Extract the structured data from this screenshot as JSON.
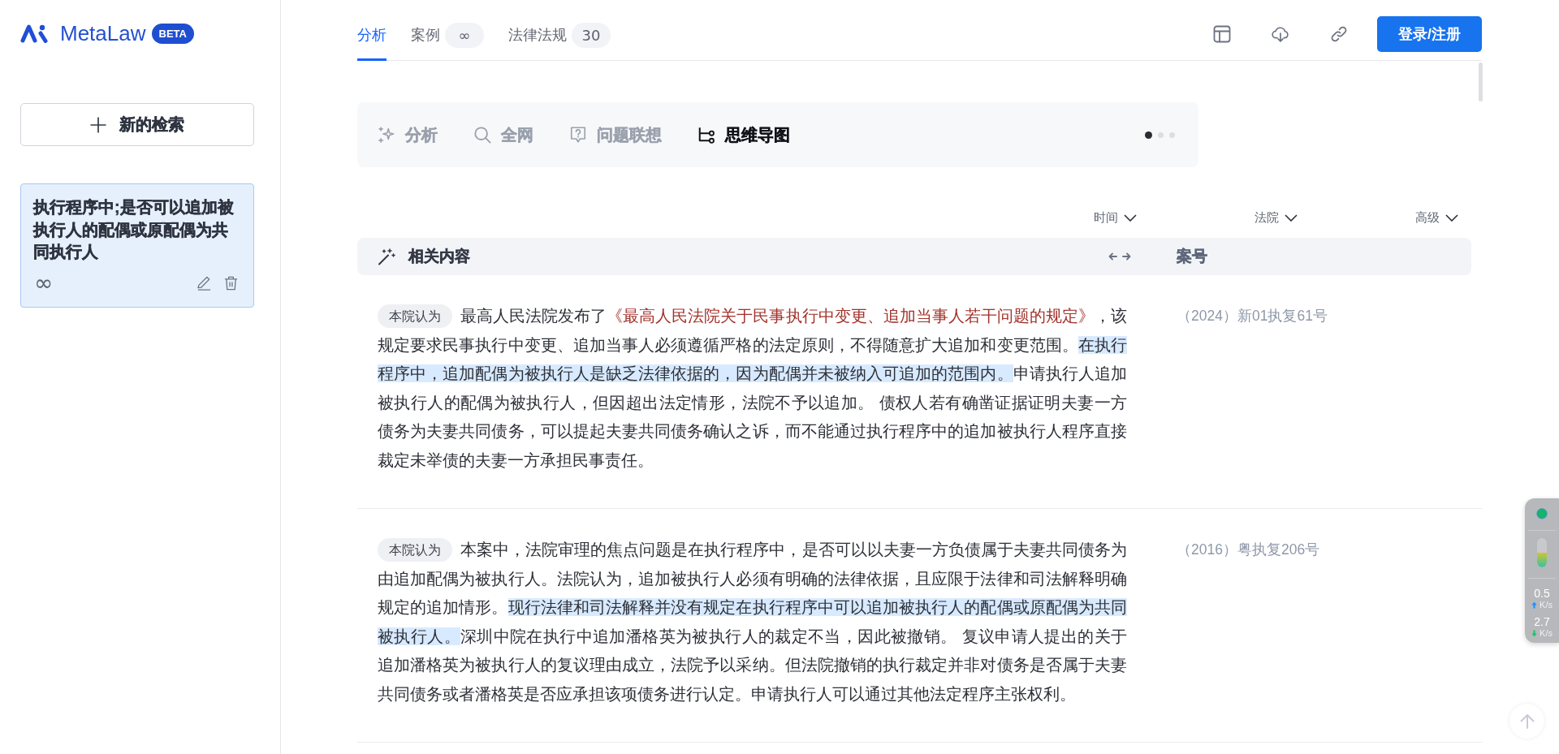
{
  "brand": {
    "name": "MetaLaw",
    "badge": "BETA"
  },
  "sidebar": {
    "new_search": "新的检索",
    "history": [
      {
        "title": "执行程序中;是否可以追加被执行人的配偶或原配偶为共同执行人",
        "count": "∞",
        "selected": true
      }
    ]
  },
  "tabs": [
    {
      "label": "分析",
      "selected": true
    },
    {
      "label": "案例",
      "count": "∞",
      "selected": false
    },
    {
      "label": "法律法规",
      "count": "30",
      "selected": false
    }
  ],
  "login_button": "登录/注册",
  "modes": {
    "items": [
      {
        "label": "分析",
        "selected": false
      },
      {
        "label": "全网",
        "selected": false
      },
      {
        "label": "问题联想",
        "selected": false
      },
      {
        "label": "思维导图",
        "selected": true
      }
    ],
    "pager": [
      {
        "selected": true
      },
      {
        "selected": false
      },
      {
        "selected": false
      }
    ]
  },
  "filters": [
    "时间",
    "法院",
    "高级"
  ],
  "results": {
    "columns": [
      "相关内容",
      "案号"
    ],
    "rows": [
      {
        "tag": "本院认为",
        "segments": [
          {
            "kind": "plain",
            "text": "最高人民法院发布了"
          },
          {
            "kind": "citation",
            "text": "《最高人民法院关于民事执行中变更、追加当事人若干问题的规定》"
          },
          {
            "kind": "plain",
            "text": "，该规定要求民事执行中变更、追加当事人必须遵循严格的法定原则，不得随意扩大追加和变更范围。"
          },
          {
            "kind": "highlight",
            "text": "在执行程序中，追加配偶为被执行人是缺乏法律依据的，因为配偶并未被纳入可追加的范围内。"
          },
          {
            "kind": "plain",
            "text": "申请执行人追加被执行人的配偶为被执行人，但因超出法定情形，法院不予以追加。 债权人若有确凿证据证明夫妻一方债务为夫妻共同债务，可以提起夫妻共同债务确认之诉，而不能通过执行程序中的追加被执行人程序直接裁定未举债的夫妻一方承担民事责任。"
          }
        ],
        "case_number": "（2024）新01执复61号"
      },
      {
        "tag": "本院认为",
        "segments": [
          {
            "kind": "plain",
            "text": "本案中，法院审理的焦点问题是在执行程序中，是否可以以夫妻一方负债属于夫妻共同债务为由追加配偶为被执行人。法院认为，追加被执行人必须有明确的法律依据，且应限于法律和司法解释明确规定的追加情形。"
          },
          {
            "kind": "highlight",
            "text": "现行法律和司法解释并没有规定在执行程序中可以追加被执行人的配偶或原配偶为共同被执行人。"
          },
          {
            "kind": "plain",
            "text": "深圳中院在执行中追加潘格英为被执行人的裁定不当，因此被撤销。 复议申请人提出的关于追加潘格英为被执行人的复议理由成立，法院予以采纳。但法院撤销的执行裁定并非对债务是否属于夫妻共同债务或者潘格英是否应承担该项债务进行认定。申请执行人可以通过其他法定程序主张权利。"
          }
        ],
        "case_number": "（2016）粤执复206号"
      }
    ]
  },
  "speed_monitor": {
    "level": 0.5,
    "upload": "0.5",
    "upload_unit": "K/s",
    "download": "2.7",
    "download_unit": "K/s"
  }
}
